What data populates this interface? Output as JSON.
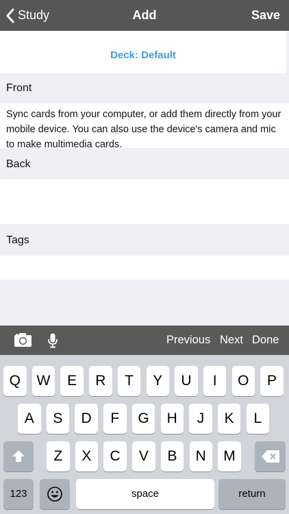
{
  "navbar": {
    "back_label": "Study",
    "title": "Add",
    "save_label": "Save"
  },
  "deck": {
    "label": "Deck: Default"
  },
  "fields": {
    "front_label": "Front",
    "front_value": "Sync cards from your computer, or add them directly from your mobile device. You can also use the device's camera and mic to make multimedia cards.",
    "back_label": "Back",
    "back_value": "",
    "tags_label": "Tags",
    "tags_value": ""
  },
  "accessory": {
    "previous_label": "Previous",
    "next_label": "Next",
    "done_label": "Done",
    "icons": [
      "camera-icon",
      "microphone-icon"
    ]
  },
  "keyboard": {
    "row1": [
      "Q",
      "W",
      "E",
      "R",
      "T",
      "Y",
      "U",
      "I",
      "O",
      "P"
    ],
    "row2": [
      "A",
      "S",
      "D",
      "F",
      "G",
      "H",
      "J",
      "K",
      "L"
    ],
    "row3": [
      "Z",
      "X",
      "C",
      "V",
      "B",
      "N",
      "M"
    ],
    "numbers_label": "123",
    "space_label": "space",
    "return_label": "return"
  },
  "colors": {
    "navbar": "#565656",
    "accent": "#3b9ee8",
    "background": "#efeff4",
    "keyboard": "#d1d4d9"
  }
}
